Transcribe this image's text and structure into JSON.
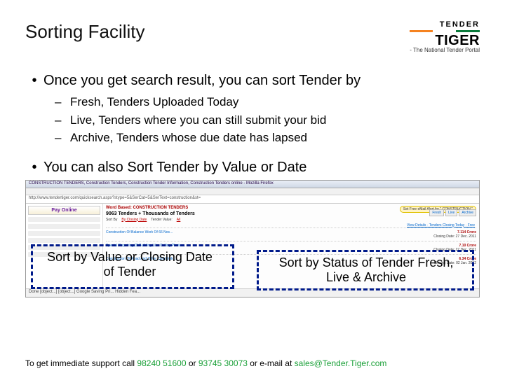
{
  "title": "Sorting Facility",
  "logo": {
    "top": "TENDER",
    "mid": "TIGER",
    "sub": "- The National Tender Portal"
  },
  "bullet1": "Once you get search result, you can sort Tender by",
  "sub_bullets": [
    "Fresh, Tenders Uploaded Today",
    "Live, Tenders where you can still submit your bid",
    "Archive, Tenders whose due date has lapsed"
  ],
  "bullet2": "You can also Sort Tender by Value or Date",
  "screenshot": {
    "window_title": "CONSTRUCTION TENDERS, Construction Tenders, Construction Tender Information, Construction Tenders online - Mozilla Firefox",
    "url": "http://www.tendertiger.com/quicksearch.aspx?stype=5&SerCat=5&SerText=construction&st=",
    "pay_online": "Pay Online",
    "word_based": "Word Based: CONSTRUCTION TENDERS",
    "alert": "Set Free eMail Alert for \" CONSTRUCTION \"",
    "count": "9063 Tenders + Thousands of Tenders",
    "filters": {
      "sort_by_label": "Sort By",
      "sort_by_value": "By Closing Date",
      "value_label": "Tender Value:",
      "value_value": "All"
    },
    "tabs": [
      "Fresh",
      "Live",
      "Archive"
    ],
    "closing_link": "View Details · Tenders Closing Today · Free",
    "cards": [
      {
        "title": "Construction Of Balance Work Of 66 Nos...",
        "value": "7.114 Crore",
        "due_label": "Closing Date:",
        "due": "27  Dec. 2011"
      },
      {
        "title": "Special Repairing Of Building Like Ceiling Plaster...",
        "value": "7.10 Crore",
        "due_label": "Closing Date:",
        "due": "27  Dec. 2011"
      },
      {
        "title": "Construction Of Road And Other Civil Work...",
        "value": "6.34 Crore",
        "due_label": "Closing Date:",
        "due": "02 Jan. 2012"
      }
    ],
    "status": "Done   [object...]   [object...]    Google    Saving Pri...    Hidden Fea..."
  },
  "callout_left": "Sort by Value or Closing Date of Tender",
  "callout_right": "Sort by Status of Tender Fresh, Live & Archive",
  "footer": {
    "prefix": "To get immediate support call ",
    "phone1": "98240 51600",
    "mid": " or ",
    "phone2": "93745 30073",
    "mid2": " or e-mail at ",
    "email": "sales@Tender.Tiger.com"
  }
}
